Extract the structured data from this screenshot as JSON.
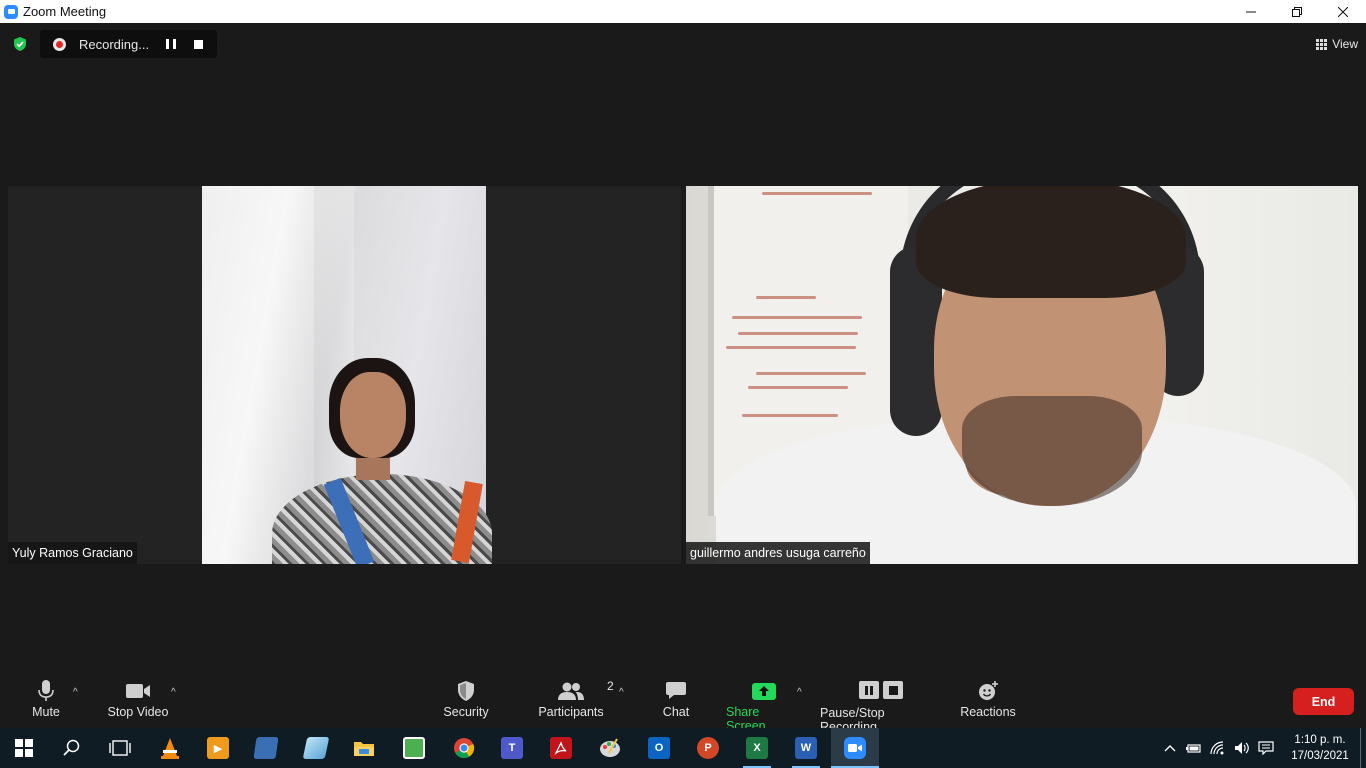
{
  "window": {
    "title": "Zoom Meeting"
  },
  "recording": {
    "label": "Recording..."
  },
  "view": {
    "label": "View"
  },
  "participants": [
    {
      "name": "Yuly Ramos Graciano"
    },
    {
      "name": "guillermo andres usuga carreño"
    }
  ],
  "toolbar": {
    "mute_label": "Mute",
    "stop_video_label": "Stop Video",
    "security_label": "Security",
    "participants_label": "Participants",
    "participants_count": "2",
    "chat_label": "Chat",
    "share_screen_label": "Share Screen",
    "pause_stop_recording_label": "Pause/Stop Recording",
    "reactions_label": "Reactions",
    "end_label": "End",
    "share_color": "#23d959",
    "end_color": "#d6201f"
  },
  "taskbar": {
    "apps": [
      {
        "icon": "windows-start-icon"
      },
      {
        "icon": "search-icon"
      },
      {
        "icon": "task-view-icon"
      },
      {
        "icon": "vlc-icon"
      },
      {
        "icon": "media-player-icon"
      },
      {
        "icon": "app-icon"
      },
      {
        "icon": "app-icon"
      },
      {
        "icon": "file-explorer-icon"
      },
      {
        "icon": "app-icon"
      },
      {
        "icon": "chrome-icon"
      },
      {
        "icon": "teams-icon",
        "letter": "T"
      },
      {
        "icon": "acrobat-icon"
      },
      {
        "icon": "paint-icon"
      },
      {
        "icon": "outlook-icon",
        "letter": "O"
      },
      {
        "icon": "powerpoint-icon",
        "letter": "P"
      },
      {
        "icon": "excel-icon",
        "letter": "X"
      },
      {
        "icon": "word-icon",
        "letter": "W"
      },
      {
        "icon": "zoom-icon"
      }
    ],
    "time": "1:10 p. m.",
    "date": "17/03/2021"
  }
}
